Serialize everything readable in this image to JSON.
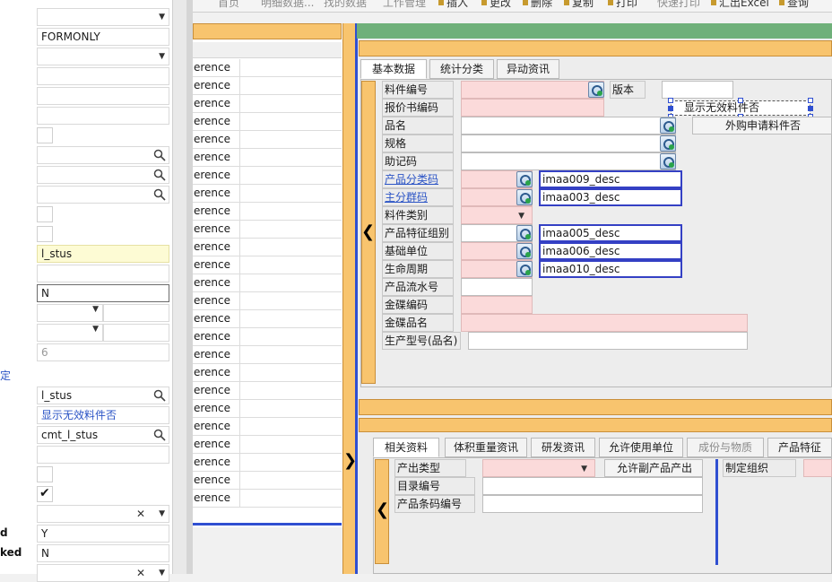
{
  "properties": {
    "rows": [
      {
        "value": ""
      },
      {
        "value": "FORMONLY"
      },
      {
        "value": ""
      },
      {
        "value": ""
      },
      {
        "value": ""
      },
      {
        "value": ""
      },
      {
        "value": "l_stus"
      },
      {
        "value": ""
      },
      {
        "value": "N"
      },
      {
        "value": "6"
      },
      {
        "value": "l_stus"
      },
      {
        "value": "显示无效料件否"
      },
      {
        "value": "cmt_l_stus"
      },
      {
        "value": ""
      },
      {
        "value": "Y"
      },
      {
        "value": "N"
      }
    ],
    "side_labels": {
      "link": "定",
      "d": "d",
      "ked": "ked"
    }
  },
  "toolbar": {
    "items": [
      "首页",
      "明细数据...",
      "找的数据",
      "工作管理",
      "插入",
      "更改",
      "删除",
      "复制",
      "打印",
      "快速打印",
      "汇出Excel",
      "查询"
    ]
  },
  "list": {
    "rows": [
      "erence",
      "erence",
      "erence",
      "erence",
      "erence",
      "erence",
      "erence",
      "erence",
      "erence",
      "erence",
      "erence",
      "erence",
      "erence",
      "erence",
      "erence",
      "erence",
      "erence",
      "erence",
      "erence",
      "erence",
      "erence",
      "erence",
      "erence",
      "erence",
      "erence"
    ]
  },
  "top_tabs": [
    "基本数据",
    "统计分类",
    "异动资讯"
  ],
  "form": {
    "item_no": "料件编号",
    "version": "版本",
    "show_invalid": "显示无效料件否",
    "quote_no": "报价书编码",
    "purchase_req": "外购申请料件否",
    "name": "品名",
    "spec": "规格",
    "mnemonic": "助记码",
    "category": "产品分类码",
    "category_desc": "imaa009_desc",
    "main_group": "主分群码",
    "main_group_desc": "imaa003_desc",
    "item_type": "料件类别",
    "feature_group": "产品特征组别",
    "feature_group_desc": "imaa005_desc",
    "base_unit": "基础单位",
    "base_unit_desc": "imaa006_desc",
    "life_cycle": "生命周期",
    "life_cycle_desc": "imaa010_desc",
    "serial": "产品流水号",
    "disc_code": "金碟编码",
    "disc_name": "金碟品名",
    "model": "生产型号(品名)"
  },
  "bottom_tabs": [
    "相关资料",
    "体积重量资讯",
    "研发资讯",
    "允许使用单位",
    "成份与物质",
    "产品特征"
  ],
  "bottom_form": {
    "product_type": "产出类型",
    "allow_byproduct": "允许副产品产出",
    "org": "制定组织",
    "catalog_no": "目录编号",
    "barcode": "产品条码编号"
  },
  "colors": {
    "orange": "#f8c46e",
    "green": "#6fb07a",
    "blue": "#2f4fd1",
    "pink": "#fbdada",
    "yellow": "#fdfbd4"
  }
}
